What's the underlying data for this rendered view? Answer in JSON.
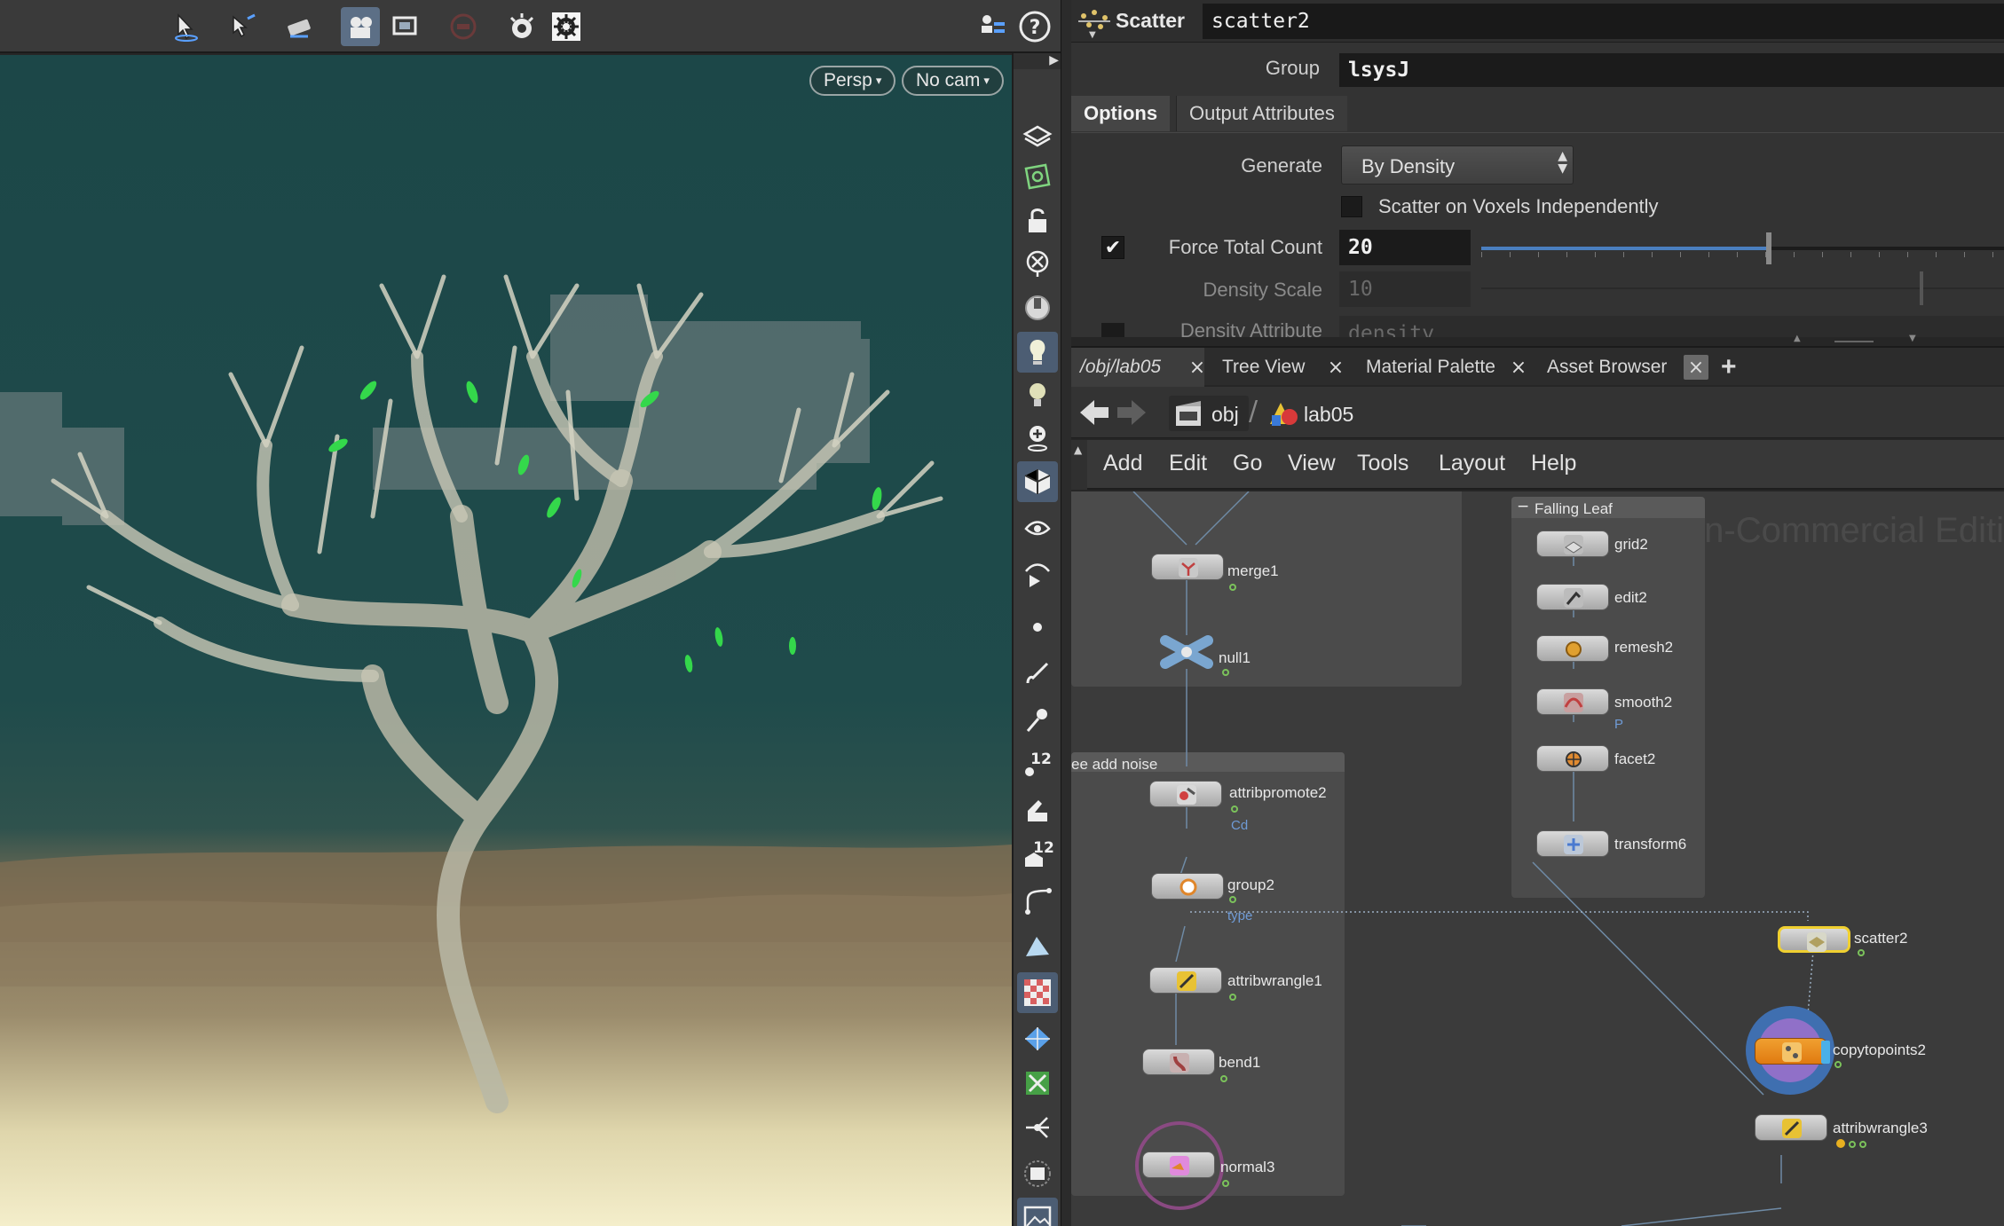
{
  "viewport": {
    "view_mode_label": "Persp",
    "camera_label": "No cam",
    "toolbar_icons": [
      "select-arrow-icon",
      "transform-select-icon",
      "pose-tool-icon",
      "view-camera-icon",
      "snapshot-icon",
      "record-stop-icon",
      "render-icon",
      "settings-icon"
    ],
    "right_toolbar_icons": [
      "users-icon",
      "help-icon"
    ]
  },
  "shelf": {
    "icons": [
      "display-options-icon",
      "layout-icon",
      "lock-icon",
      "remove-icon",
      "lens-icon",
      "light-icon",
      "light-alt-icon",
      "light-add-icon",
      "shading-icon",
      "ghost-icon",
      "ghost-play-icon",
      "point-icon",
      "brush-icon",
      "pin-icon",
      "points-12-icon",
      "clip-icon",
      "points-12-alt-icon",
      "curve-icon",
      "sculpt-icon",
      "checker-icon",
      "geometry-icon",
      "bounds-icon",
      "handle-icon",
      "panel-icon",
      "image-icon"
    ],
    "badge": "12"
  },
  "params": {
    "node_type": "Scatter",
    "node_name": "scatter2",
    "group_label": "Group",
    "group_value": "lsysJ",
    "tabs": [
      "Options",
      "Output Attributes"
    ],
    "generate_label": "Generate",
    "generate_value": "By Density",
    "voxels_label": "Scatter on Voxels Independently",
    "force_total_label": "Force Total Count",
    "force_total_value": "20",
    "density_scale_label": "Density Scale",
    "density_scale_value": "10",
    "density_attr_label": "Density Attribute",
    "density_attr_value": "density",
    "force_total_slider_fraction": 0.55
  },
  "network": {
    "tabs": [
      {
        "label": "/obj/lab05"
      },
      {
        "label": "Tree View"
      },
      {
        "label": "Material Palette"
      },
      {
        "label": "Asset Browser"
      }
    ],
    "add_tab": "+",
    "path": [
      "obj",
      "lab05"
    ],
    "menu": [
      "Add",
      "Edit",
      "Go",
      "View",
      "Tools",
      "Layout",
      "Help"
    ],
    "watermark": "Non-Commercial Editi",
    "boxes": {
      "noise_title": "ee add noise",
      "falling_leaf_title": "Falling Leaf"
    },
    "nodes": {
      "merge1": "merge1",
      "null1": "null1",
      "attribpromote2": "attribpromote2",
      "attribpromote2_sub": "Cd",
      "group2": "group2",
      "group2_sub": "type",
      "attribwrangle1": "attribwrangle1",
      "bend1": "bend1",
      "normal3": "normal3",
      "grid2": "grid2",
      "edit2": "edit2",
      "remesh2": "remesh2",
      "smooth2": "smooth2",
      "smooth2_sub": "P",
      "facet2": "facet2",
      "transform6": "transform6",
      "scatter2": "scatter2",
      "copytopoints2": "copytopoints2",
      "attribwrangle3": "attribwrangle3"
    }
  }
}
